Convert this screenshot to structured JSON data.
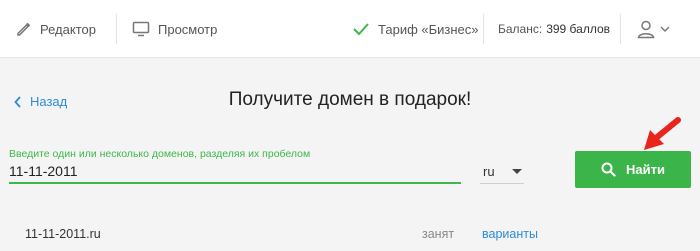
{
  "topbar": {
    "editor_label": "Редактор",
    "preview_label": "Просмотр",
    "tariff_label": "Тариф «Бизнес»",
    "balance_label": "Баланс:",
    "balance_value": "399 баллов",
    "icons": {
      "editor": "pencil-icon",
      "preview": "monitor-icon",
      "tariff": "check-icon",
      "user": "user-icon",
      "user_menu": "chevron-down-icon"
    },
    "tariff_color": "#3db84a"
  },
  "main": {
    "back_label": "Назад",
    "title": "Получите домен в подарок!",
    "domain_input": {
      "label": "Введите один или несколько доменов, разделяя их пробелом",
      "value": "11-11-2011"
    },
    "zone_select": {
      "selected": "ru"
    },
    "find_button": {
      "label": "Найти",
      "icon": "search-icon",
      "color": "#3bb54a"
    },
    "annotation_arrow_color": "#e8251d"
  },
  "results": [
    {
      "domain": "11-11-2011.ru",
      "status": "занят",
      "action": "варианты"
    }
  ]
}
